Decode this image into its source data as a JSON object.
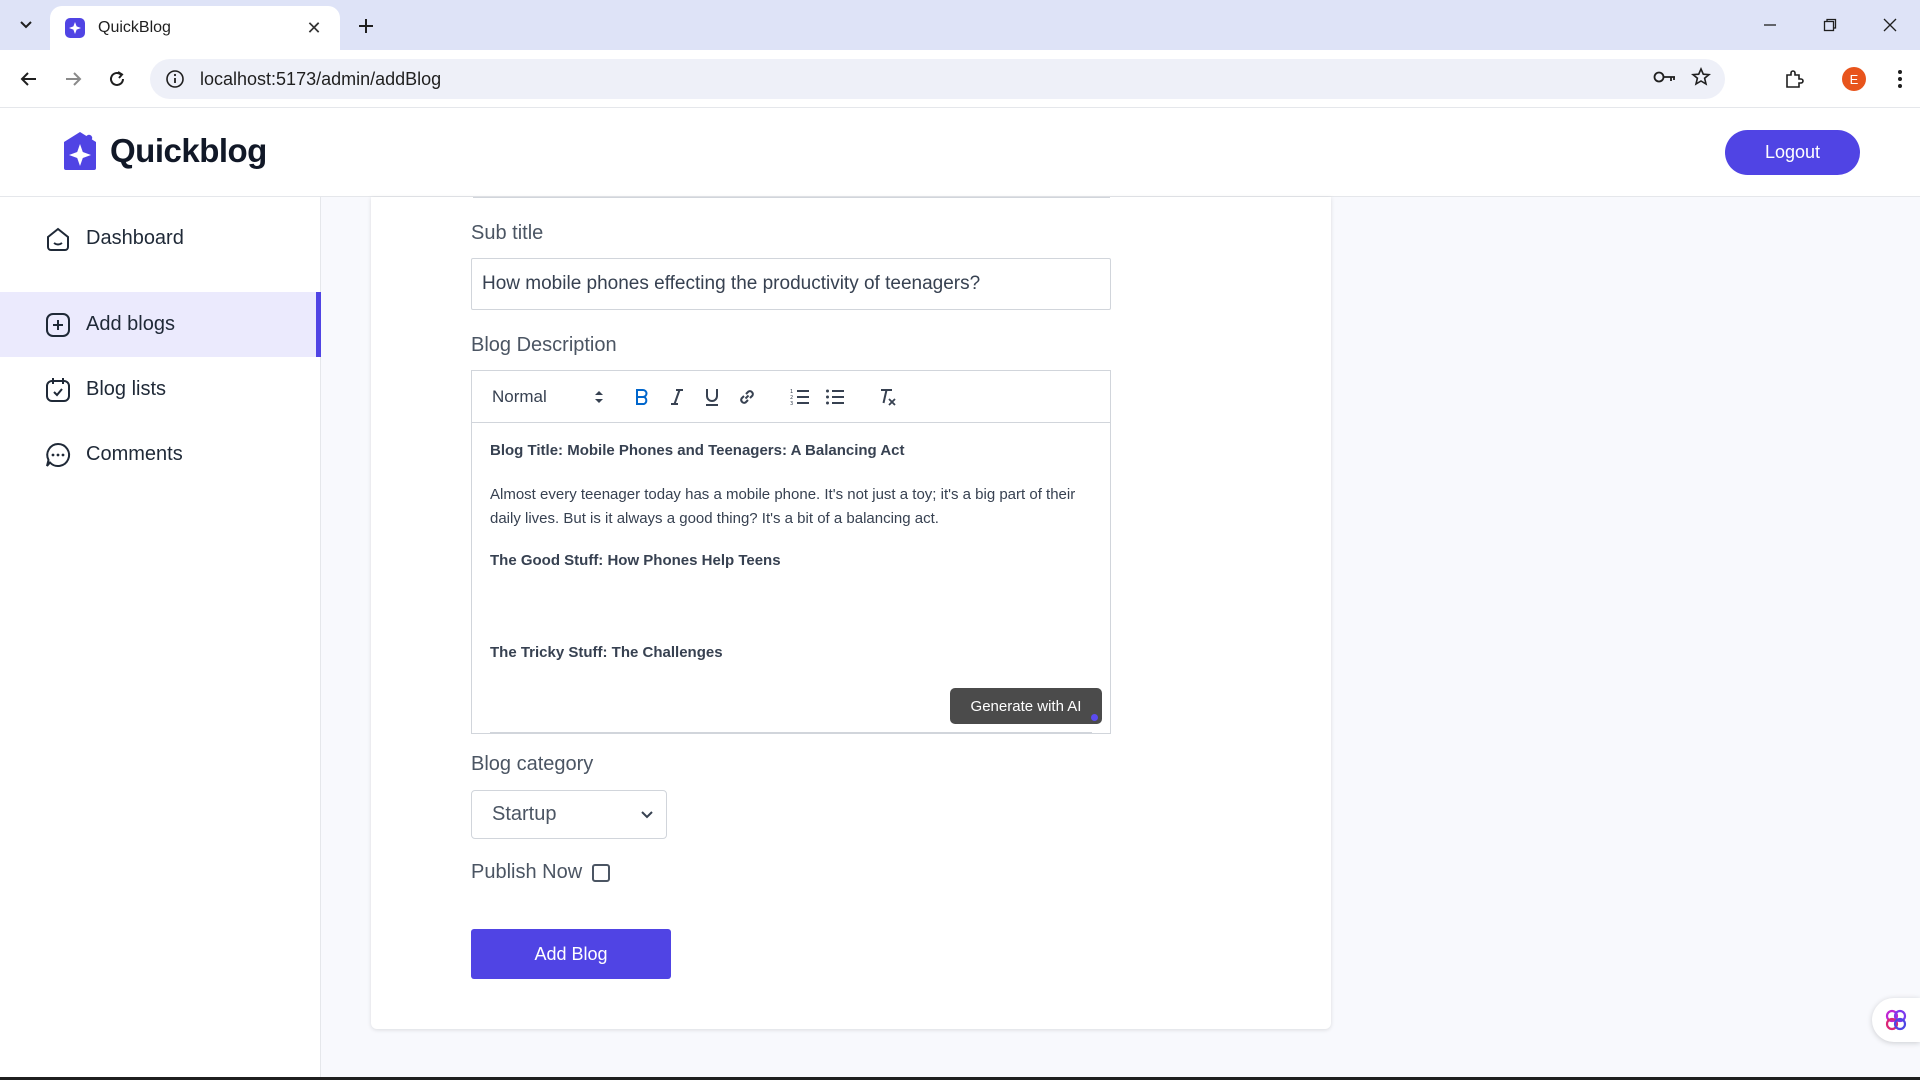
{
  "browser": {
    "tab_title": "QuickBlog",
    "url": "localhost:5173/admin/addBlog",
    "profile_initial": "E"
  },
  "header": {
    "brand_name": "Quickblog",
    "logout_label": "Logout",
    "accent_color": "#5044e4"
  },
  "sidebar": {
    "items": [
      {
        "label": "Dashboard",
        "icon": "home-icon",
        "active": false
      },
      {
        "label": "Add blogs",
        "icon": "add-square-icon",
        "active": true
      },
      {
        "label": "Blog lists",
        "icon": "calendar-check-icon",
        "active": false
      },
      {
        "label": "Comments",
        "icon": "chat-bubble-icon",
        "active": false
      }
    ]
  },
  "form": {
    "subtitle_label": "Sub title",
    "subtitle_value": "How mobile phones effecting the productivity of teenagers?",
    "description_label": "Blog Description",
    "editor": {
      "format_select": "Normal",
      "heading_1": "Blog Title: Mobile Phones and Teenagers: A Balancing Act",
      "paragraph_1": "Almost every teenager today has a mobile phone. It's not just a toy; it's a big part of their daily lives. But is it always a good thing? It's a bit of a balancing act.",
      "heading_2": "The Good Stuff: How Phones Help Teens",
      "heading_3": "The Tricky Stuff: The Challenges",
      "generate_label": "Generate with AI"
    },
    "category_label": "Blog category",
    "category_value": "Startup",
    "publish_label": "Publish Now",
    "publish_checked": false,
    "submit_label": "Add Blog"
  }
}
